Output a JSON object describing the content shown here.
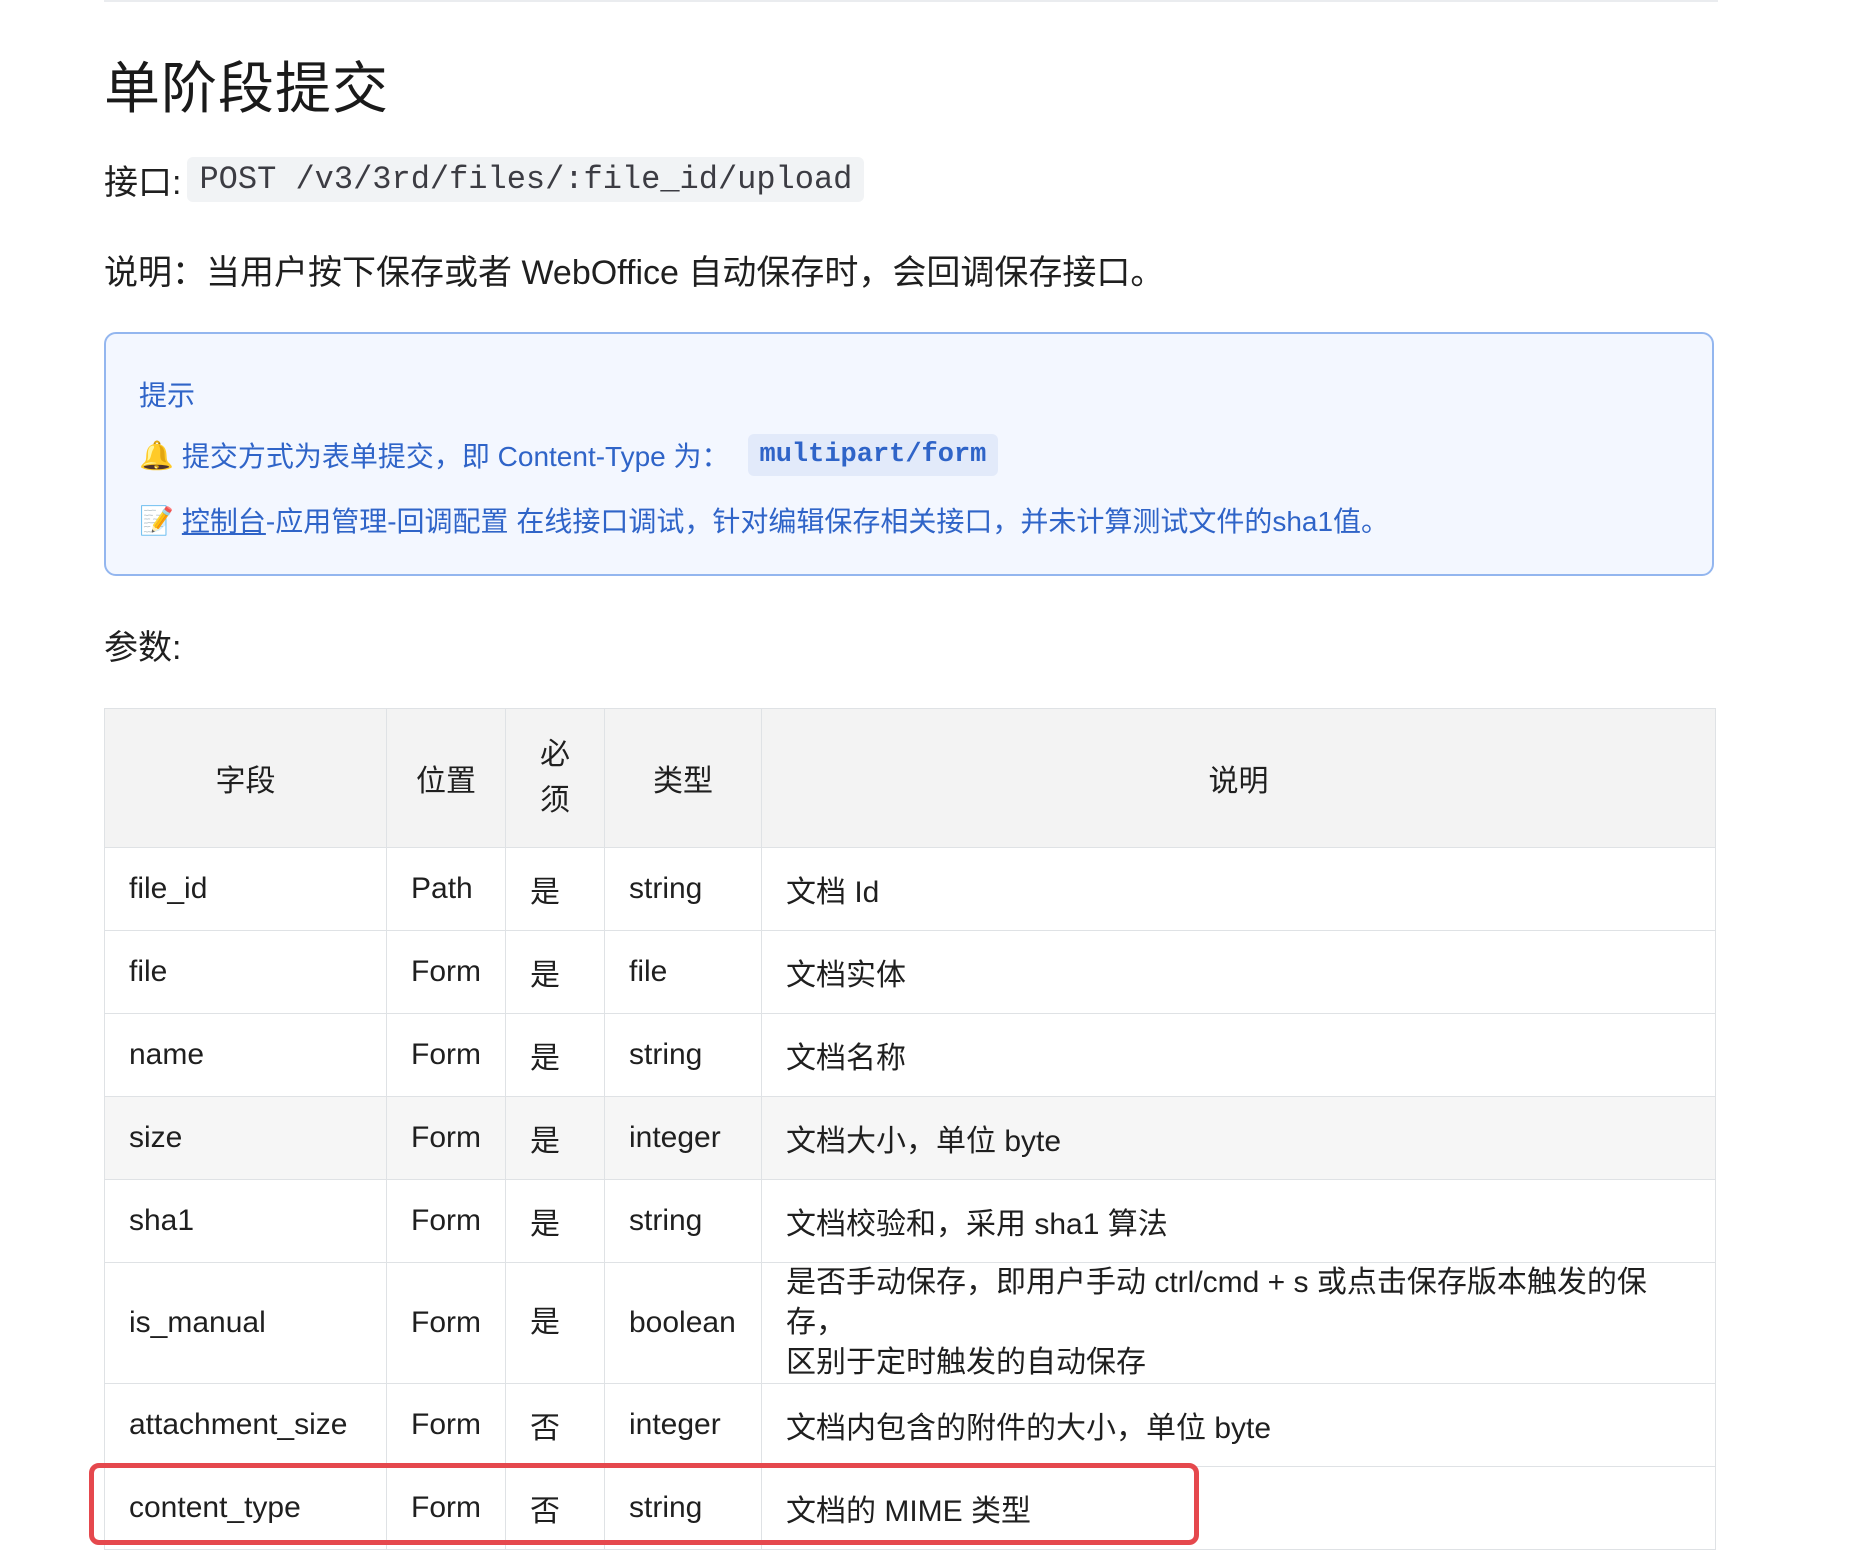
{
  "title": "单阶段提交",
  "api": {
    "label": "接口:",
    "endpoint": "POST /v3/3rd/files/:file_id/upload"
  },
  "description": "说明：当用户按下保存或者 WebOffice 自动保存时，会回调保存接口。",
  "tip": {
    "title": "提示",
    "line1_icon": "bell-icon",
    "line1_text": "提交方式为表单提交，即 Content-Type 为：",
    "line1_code": "multipart/form",
    "line2_icon": "memo-icon",
    "line2_link": "控制台",
    "line2_text": "-应用管理-回调配置 在线接口调试，针对编辑保存相关接口，并未计算测试文件的sha1值。"
  },
  "params_label": "参数:",
  "table": {
    "headers": {
      "field": "字段",
      "location": "位置",
      "required_top": "必",
      "required_bottom": "须",
      "type": "类型",
      "description": "说明"
    },
    "rows": [
      {
        "field": "file_id",
        "location": "Path",
        "required": "是",
        "type": "string",
        "description": "文档 Id"
      },
      {
        "field": "file",
        "location": "Form",
        "required": "是",
        "type": "file",
        "description": "文档实体"
      },
      {
        "field": "name",
        "location": "Form",
        "required": "是",
        "type": "string",
        "description": "文档名称"
      },
      {
        "field": "size",
        "location": "Form",
        "required": "是",
        "type": "integer",
        "description": "文档大小，单位 byte"
      },
      {
        "field": "sha1",
        "location": "Form",
        "required": "是",
        "type": "string",
        "description": "文档校验和，采用 sha1 算法"
      },
      {
        "field": "is_manual",
        "location": "Form",
        "required": "是",
        "type": "boolean",
        "description_line1": "是否手动保存，即用户手动 ctrl/cmd + s 或点击保存版本触发的保存，",
        "description_line2": "区别于定时触发的自动保存"
      },
      {
        "field": "attachment_size",
        "location": "Form",
        "required": "否",
        "type": "integer",
        "description": "文档内包含的附件的大小，单位 byte"
      },
      {
        "field": "content_type",
        "location": "Form",
        "required": "否",
        "type": "string",
        "description": "文档的 MIME 类型"
      }
    ]
  },
  "colors": {
    "accent_blue": "#2f64c8",
    "tip_border": "#93b6ef",
    "tip_bg": "#f3f7ff",
    "highlight_red": "#e5484d"
  }
}
